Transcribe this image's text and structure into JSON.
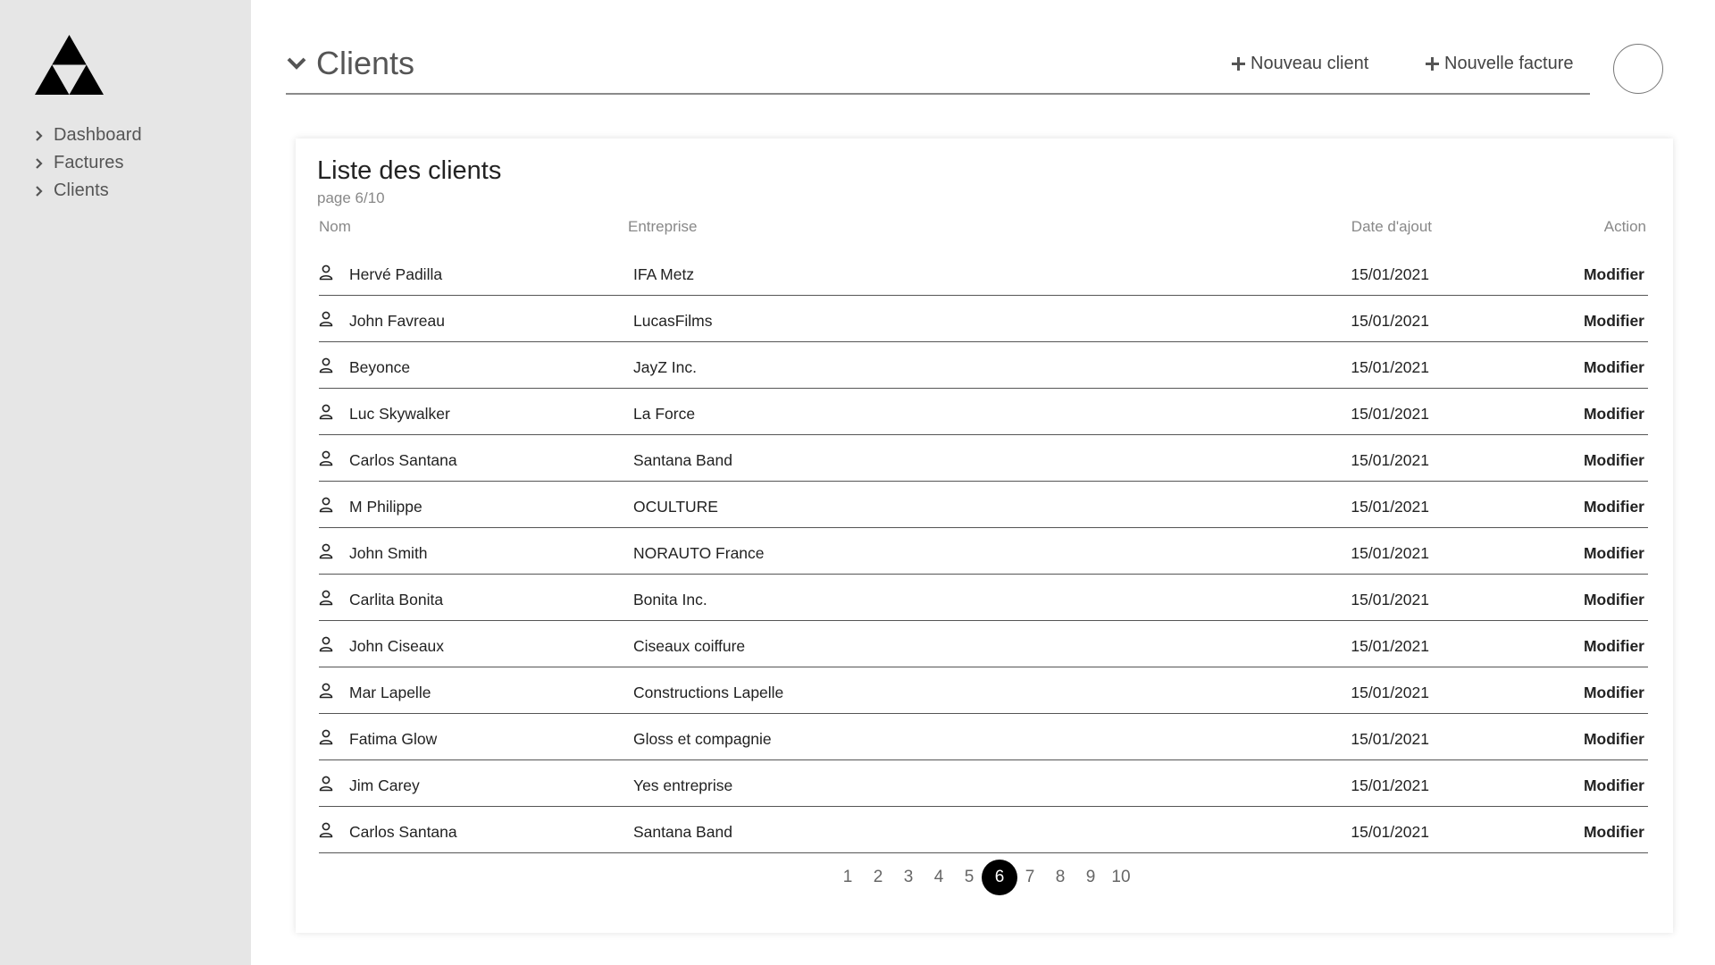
{
  "sidebar": {
    "items": [
      {
        "label": "Dashboard"
      },
      {
        "label": "Factures"
      },
      {
        "label": "Clients"
      }
    ]
  },
  "header": {
    "title": "Clients",
    "new_client_label": "Nouveau client",
    "new_invoice_label": "Nouvelle facture"
  },
  "card": {
    "title": "Liste des clients",
    "subtitle": "page 6/10"
  },
  "table": {
    "columns": {
      "name": "Nom",
      "company": "Entreprise",
      "date": "Date d'ajout",
      "action": "Action"
    },
    "rows": [
      {
        "name": "Hervé Padilla",
        "company": "IFA Metz",
        "date": "15/01/2021",
        "action": "Modifier"
      },
      {
        "name": "John Favreau",
        "company": "LucasFilms",
        "date": "15/01/2021",
        "action": "Modifier"
      },
      {
        "name": "Beyonce",
        "company": "JayZ Inc.",
        "date": "15/01/2021",
        "action": "Modifier"
      },
      {
        "name": "Luc Skywalker",
        "company": "La Force",
        "date": "15/01/2021",
        "action": "Modifier"
      },
      {
        "name": "Carlos Santana",
        "company": "Santana Band",
        "date": "15/01/2021",
        "action": "Modifier"
      },
      {
        "name": "M Philippe",
        "company": "OCULTURE",
        "date": "15/01/2021",
        "action": "Modifier"
      },
      {
        "name": "John Smith",
        "company": "NORAUTO France",
        "date": "15/01/2021",
        "action": "Modifier"
      },
      {
        "name": "Carlita Bonita",
        "company": "Bonita Inc.",
        "date": "15/01/2021",
        "action": "Modifier"
      },
      {
        "name": "John Ciseaux",
        "company": "Ciseaux coiffure",
        "date": "15/01/2021",
        "action": "Modifier"
      },
      {
        "name": "Mar Lapelle",
        "company": "Constructions Lapelle",
        "date": "15/01/2021",
        "action": "Modifier"
      },
      {
        "name": "Fatima Glow",
        "company": "Gloss et compagnie",
        "date": "15/01/2021",
        "action": "Modifier"
      },
      {
        "name": "Jim Carey",
        "company": "Yes entreprise",
        "date": "15/01/2021",
        "action": "Modifier"
      },
      {
        "name": "Carlos Santana",
        "company": "Santana Band",
        "date": "15/01/2021",
        "action": "Modifier"
      }
    ]
  },
  "pagination": {
    "pages": [
      "1",
      "2",
      "3",
      "4",
      "5",
      "6",
      "7",
      "8",
      "9",
      "10"
    ],
    "current": "6"
  },
  "colors": {
    "sidebar_bg": "#e6e6e6",
    "active_page_bg": "#000000"
  },
  "icons": {
    "logo": "triforce-logo",
    "nav": "chevron-right-icon",
    "title": "chevron-down-icon",
    "add": "plus-icon",
    "row": "user-icon"
  }
}
